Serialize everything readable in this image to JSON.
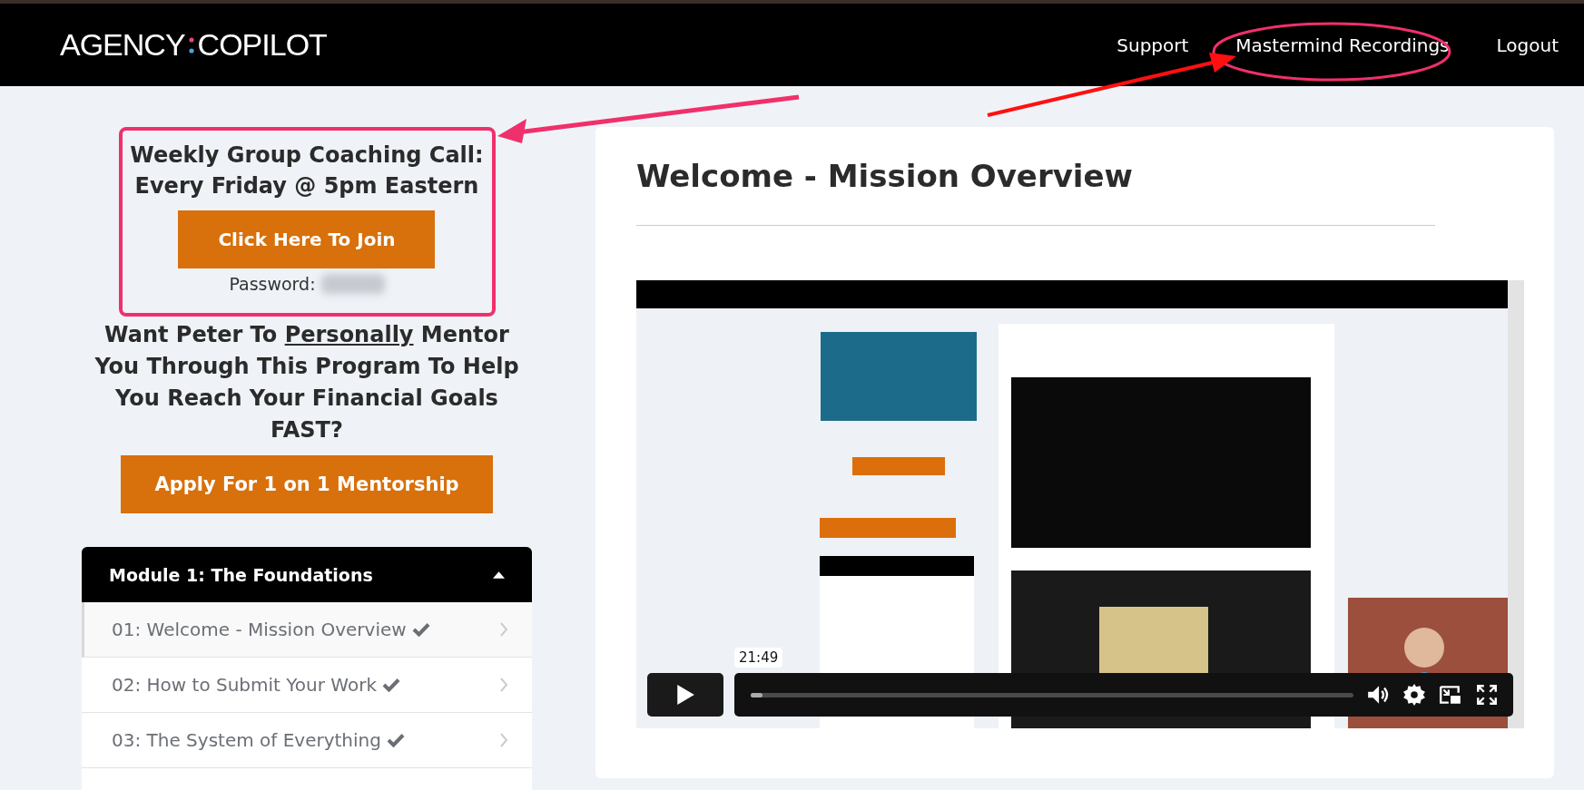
{
  "header": {
    "logo": {
      "left": "AGENCY",
      "right": "COPILOT"
    },
    "nav": [
      {
        "label": "Support"
      },
      {
        "label": "Mastermind Recordings"
      },
      {
        "label": "Logout"
      }
    ]
  },
  "sidebar": {
    "coaching_title": [
      "Weekly Group Coaching Call:",
      "Every Friday @ 5pm Eastern"
    ],
    "join_button": "Click Here To Join",
    "password_label": "Password:",
    "mentor_text": {
      "before": "Want Peter To ",
      "underlined": "Personally",
      "after": " Mentor You Through This Program To Help You Reach Your Financial Goals FAST?"
    },
    "mentor_button": "Apply For 1 on 1 Mentorship",
    "module": {
      "title": "Module 1: The Foundations",
      "expanded": true,
      "lessons": [
        {
          "label": "01: Welcome - Mission Overview",
          "completed": true,
          "selected": true
        },
        {
          "label": "02: How to Submit Your Work",
          "completed": true,
          "selected": false
        },
        {
          "label": "03: The System of Everything",
          "completed": true,
          "selected": false
        }
      ]
    }
  },
  "content": {
    "title": "Welcome - Mission Overview",
    "video": {
      "kind": "picture",
      "time_tooltip": "21:49",
      "level": 0.02
    }
  }
}
